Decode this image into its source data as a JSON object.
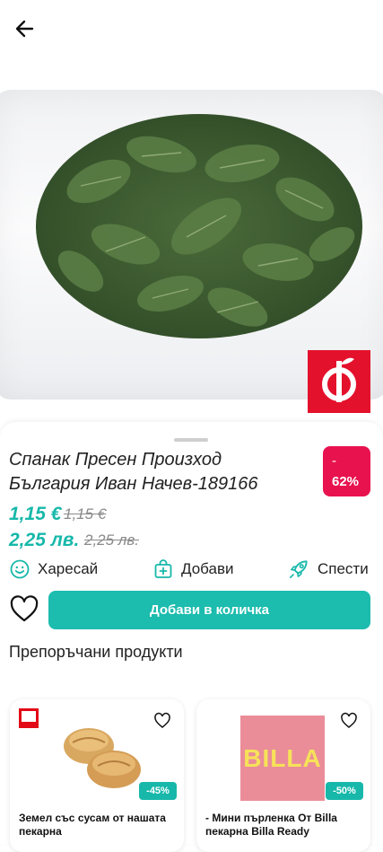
{
  "product": {
    "title": "Спанак Пресен Произход България Иван Начев-189166",
    "discount_sign": "-",
    "discount_percent": "62%",
    "price_eur": "1,15 €",
    "old_price_eur": "1,15 €",
    "price_bgn": "2,25 лв.",
    "old_price_bgn": "2,25 лв."
  },
  "actions": {
    "like_label": "Харесай",
    "add_label": "Добави",
    "save_label": "Спести"
  },
  "cart": {
    "button_label": "Добави в количка"
  },
  "recommended": {
    "heading": "Препоръчани продукти",
    "items": [
      {
        "name": "Земел със сусам от нашата пекарна",
        "discount": "-45%",
        "store": "Kaufland"
      },
      {
        "name": "- Мини пърленка От Billa пекарна Billa Ready",
        "discount": "-50%",
        "store": "BILLA"
      }
    ]
  },
  "colors": {
    "accent": "#1cbcae",
    "discount": "#e8124f",
    "vendor": "#e4112c"
  }
}
